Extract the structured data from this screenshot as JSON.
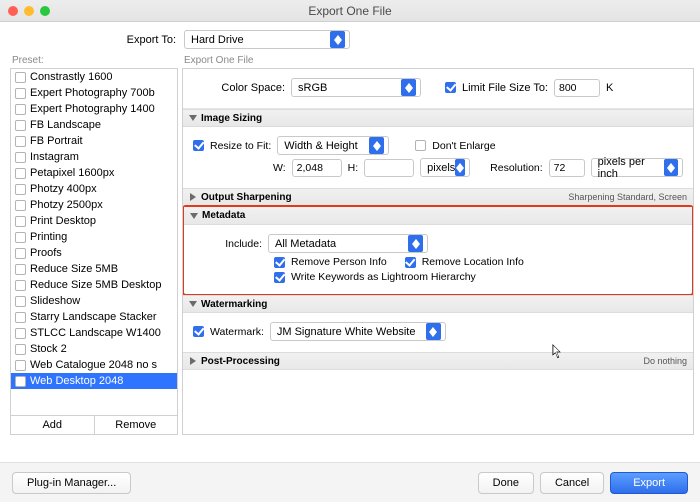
{
  "window": {
    "title": "Export One File"
  },
  "exportTo": {
    "label": "Export To:",
    "value": "Hard Drive"
  },
  "preset": {
    "label": "Preset:",
    "items": [
      {
        "label": "Constrastly 1600",
        "checked": false
      },
      {
        "label": "Expert Photography 700b",
        "checked": false
      },
      {
        "label": "Expert Photography 1400",
        "checked": false
      },
      {
        "label": "FB Landscape",
        "checked": false
      },
      {
        "label": "FB Portrait",
        "checked": false
      },
      {
        "label": "Instagram",
        "checked": false
      },
      {
        "label": "Petapixel 1600px",
        "checked": false
      },
      {
        "label": "Photzy 400px",
        "checked": false
      },
      {
        "label": "Photzy 2500px",
        "checked": false
      },
      {
        "label": "Print Desktop",
        "checked": false
      },
      {
        "label": "Printing",
        "checked": false
      },
      {
        "label": "Proofs",
        "checked": false
      },
      {
        "label": "Reduce Size 5MB",
        "checked": false
      },
      {
        "label": "Reduce Size 5MB Desktop",
        "checked": false
      },
      {
        "label": "Slideshow",
        "checked": false
      },
      {
        "label": "Starry Landscape Stacker",
        "checked": false
      },
      {
        "label": "STLCC Landscape W1400",
        "checked": false
      },
      {
        "label": "Stock 2",
        "checked": false
      },
      {
        "label": "Web Catalogue 2048 no s",
        "checked": false
      },
      {
        "label": "Web Desktop 2048",
        "checked": false,
        "selected": true
      }
    ],
    "addLabel": "Add",
    "removeLabel": "Remove"
  },
  "breadcrumb": "Export One File",
  "colorSpace": {
    "label": "Color Space:",
    "value": "sRGB"
  },
  "limitSize": {
    "checked": true,
    "label": "Limit File Size To:",
    "value": "800",
    "unit": "K"
  },
  "imageSizing": {
    "title": "Image Sizing",
    "resize": {
      "checked": true,
      "label": "Resize to Fit:",
      "value": "Width & Height"
    },
    "dontEnlarge": {
      "checked": false,
      "label": "Don't Enlarge"
    },
    "wLabel": "W:",
    "wValue": "2,048",
    "hLabel": "H:",
    "hValue": "",
    "pixelsValue": "pixels",
    "resLabel": "Resolution:",
    "resValue": "72",
    "ppiValue": "pixels per inch"
  },
  "outputSharpening": {
    "title": "Output Sharpening",
    "summary": "Sharpening Standard, Screen"
  },
  "metadata": {
    "title": "Metadata",
    "includeLabel": "Include:",
    "includeValue": "All Metadata",
    "removePerson": {
      "checked": true,
      "label": "Remove Person Info"
    },
    "removeLocation": {
      "checked": true,
      "label": "Remove Location Info"
    },
    "writeKeywords": {
      "checked": true,
      "label": "Write Keywords as Lightroom Hierarchy"
    }
  },
  "watermarking": {
    "title": "Watermarking",
    "checked": true,
    "label": "Watermark:",
    "value": "JM Signature White Website"
  },
  "postProcessing": {
    "title": "Post-Processing",
    "summary": "Do nothing"
  },
  "footer": {
    "plugin": "Plug-in Manager...",
    "done": "Done",
    "cancel": "Cancel",
    "export": "Export"
  }
}
